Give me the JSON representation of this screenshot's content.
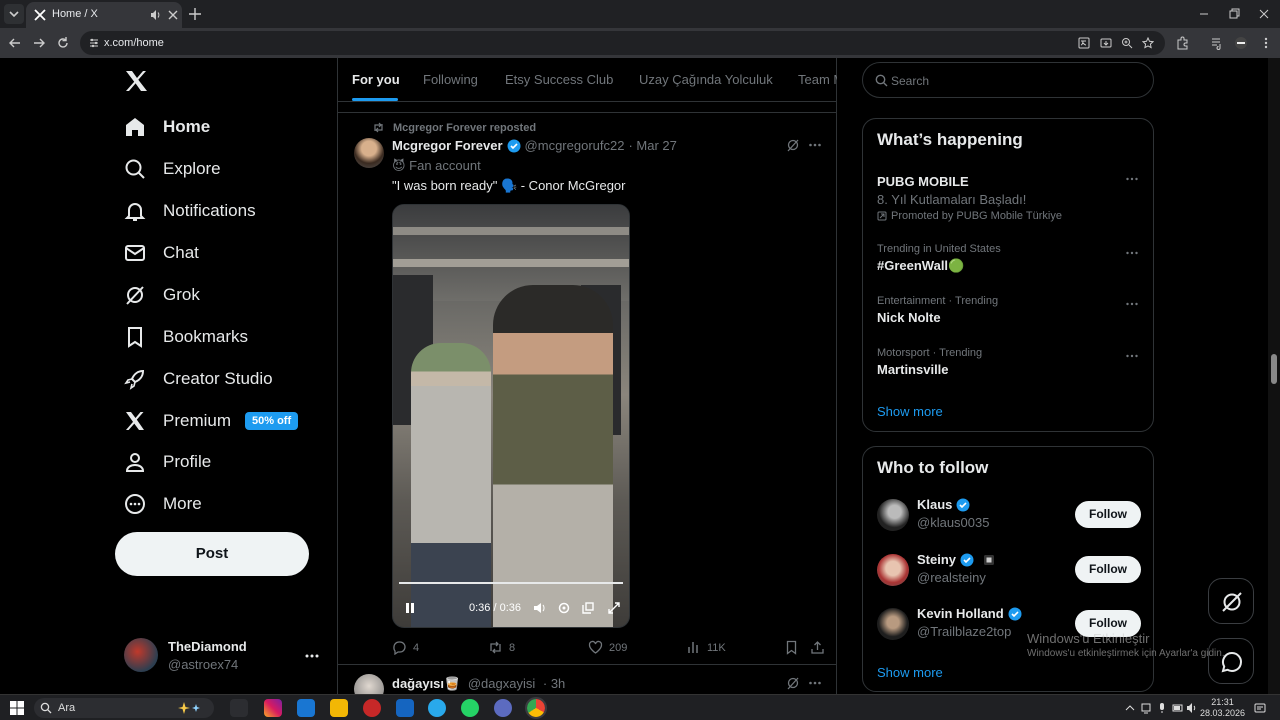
{
  "browser": {
    "tab_title": "Home / X",
    "url": "x.com/home"
  },
  "nav": {
    "items": [
      {
        "label": "Home",
        "icon": "home-icon",
        "active": true
      },
      {
        "label": "Explore",
        "icon": "search-icon"
      },
      {
        "label": "Notifications",
        "icon": "bell-icon"
      },
      {
        "label": "Chat",
        "icon": "mail-icon"
      },
      {
        "label": "Grok",
        "icon": "grok-icon"
      },
      {
        "label": "Bookmarks",
        "icon": "bookmark-icon"
      },
      {
        "label": "Creator Studio",
        "icon": "rocket-icon"
      },
      {
        "label": "Premium",
        "icon": "x-logo-icon",
        "badge": "50% off"
      },
      {
        "label": "Profile",
        "icon": "person-icon"
      },
      {
        "label": "More",
        "icon": "more-circle-icon"
      }
    ],
    "post_label": "Post",
    "account": {
      "name": "TheDiamond",
      "handle": "@astroex74"
    }
  },
  "feed": {
    "tabs": [
      "For you",
      "Following",
      "Etsy Success Club",
      "Uzay Çağında Yolculuk",
      "Team M"
    ],
    "tweet": {
      "repost_text": "Mcgregor Forever reposted",
      "name": "Mcgregor Forever",
      "handle": "@mcgregorufc22",
      "date": "· Mar 27",
      "fan_account": "😈 Fan account",
      "text": "\"I was born ready\" 🗣️ - Conor McGregor",
      "video_time": "0:36 / 0:36",
      "video_progress": 1.0,
      "replies": "4",
      "reposts": "8",
      "likes": "209",
      "views": "11K"
    },
    "tweet2": {
      "name": "dağayısı🥃",
      "handle": "@dagxayisi",
      "time": "· 3h"
    }
  },
  "right": {
    "search_placeholder": "Search",
    "happening_title": "What’s happening",
    "trends": [
      {
        "meta": "",
        "title": "PUBG MOBILE",
        "sub": "8. Yıl Kutlamaları Başladı!",
        "promo": "Promoted by PUBG Mobile Türkiye"
      },
      {
        "meta": "Trending in United States",
        "title": "#GreenWall🟢"
      },
      {
        "meta": "Entertainment · Trending",
        "title": "Nick Nolte"
      },
      {
        "meta": "Motorsport · Trending",
        "title": "Martinsville"
      }
    ],
    "show_more": "Show more",
    "who_title": "Who to follow",
    "follow": [
      {
        "name": "Klaus",
        "handle": "@klaus0035"
      },
      {
        "name": "Steiny",
        "handle": "@realsteiny"
      },
      {
        "name": "Kevin Holland",
        "handle": "@Trailblaze2top"
      }
    ],
    "follow_label": "Follow",
    "show_more_2": "Show more"
  },
  "watermark": {
    "line1": "Windows'u Etkinleştir",
    "line2": "Windows'u etkinleştirmek için Ayarlar'a gidin."
  },
  "taskbar": {
    "search_text": "Ara",
    "time": "21:31",
    "date": "28.03.2026"
  },
  "colors": {
    "accent": "#1d9bf0",
    "background": "#000000",
    "text": "#e7e9ea",
    "muted": "#71767b"
  }
}
